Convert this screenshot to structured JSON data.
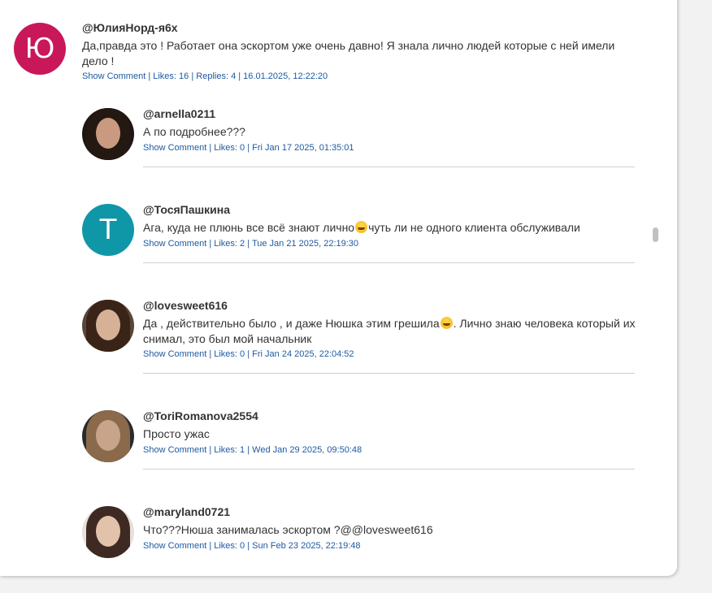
{
  "main_comment": {
    "avatar_letter": "Ю",
    "avatar_color": "#c8185a",
    "username": "@ЮлияНорд-я6х",
    "text": "Да,правда это ! Работает она эскортом уже очень давно! Я знала лично людей которые с ней имели дело !",
    "show_comment": "Show Comment",
    "likes": "Likes: 16",
    "replies": "Replies: 4",
    "date": "16.01.2025, 12:22:20"
  },
  "replies": [
    {
      "avatar_type": "photo",
      "username": "@arnella0211",
      "text": "А по подробнее???",
      "show_comment": "Show Comment",
      "likes": "Likes: 0",
      "date": "Fri Jan 17 2025, 01:35:01"
    },
    {
      "avatar_type": "letter",
      "avatar_letter": "T",
      "avatar_color": "#0f97a8",
      "username": "@ТосяПашкина",
      "text_before": "Ага, куда не плюнь все всё знают лично",
      "emoji_icon": "grinning-sweat-emoji",
      "text_after": "чуть ли не одного клиента обслуживали",
      "show_comment": "Show Comment",
      "likes": "Likes: 2",
      "date": "Tue Jan 21 2025, 22:19:30"
    },
    {
      "avatar_type": "photo",
      "username": "@lovesweet616",
      "text_before": "Да , действительно было , и даже Нюшка этим грешила",
      "emoji_icon": "grinning-sweat-emoji",
      "text_after": ". Лично знаю человека который их снимал, это был мой начальник",
      "show_comment": "Show Comment",
      "likes": "Likes: 0",
      "date": "Fri Jan 24 2025, 22:04:52"
    },
    {
      "avatar_type": "photo",
      "username": "@ToriRomanova2554",
      "text": "Просто ужас",
      "show_comment": "Show Comment",
      "likes": "Likes: 1",
      "date": "Wed Jan 29 2025, 09:50:48"
    },
    {
      "avatar_type": "photo",
      "username": "@maryland0721",
      "text": "Что???Нюша занималась эскортом ?@@lovesweet616",
      "show_comment": "Show Comment",
      "likes": "Likes: 0",
      "date": "Sun Feb 23 2025, 22:19:48"
    }
  ],
  "meta_separator": "|",
  "colors": {
    "link": "#1e5aa0",
    "text": "#333333",
    "background": "#f2f2f2"
  }
}
